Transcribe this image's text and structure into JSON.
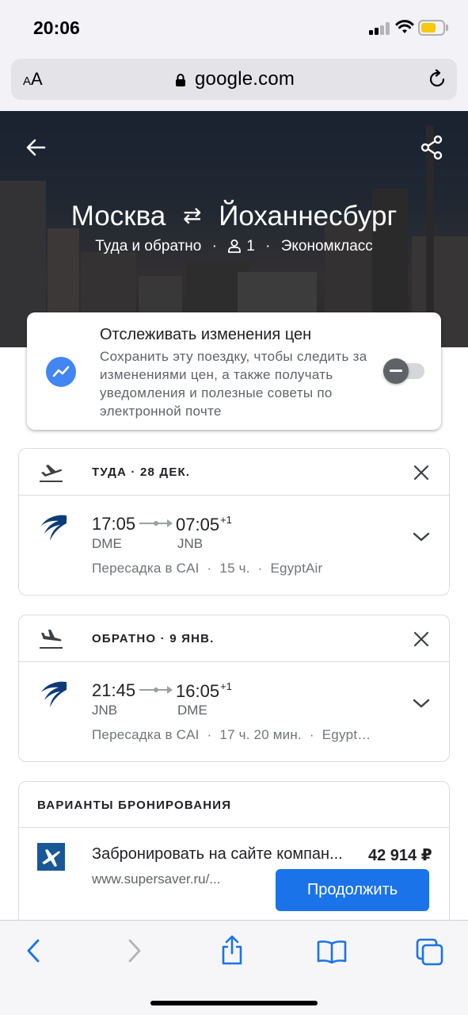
{
  "status_bar": {
    "time": "20:06",
    "battery_level": 0.7,
    "battery_color": "#f7c811"
  },
  "browser": {
    "text_size_label_small": "A",
    "text_size_label_large": "A",
    "url": "google.com"
  },
  "hero": {
    "origin": "Москва",
    "destination": "Йоханнесбург",
    "swap_glyph": "⇄",
    "trip_type": "Туда и обратно",
    "passengers": "1",
    "cabin_class": "Экономкласс",
    "separator": "·"
  },
  "price_tracking": {
    "title": "Отслеживать изменения цен",
    "description": "Сохранить эту поездку, чтобы следить за изменениями цен, а также получать уведомления и полезные советы по электронной почте",
    "enabled": false
  },
  "flights": [
    {
      "label": "ТУДА · 28 ДЕК.",
      "depart_time": "17:05",
      "arrive_time": "07:05",
      "day_offset": "+1",
      "from_code": "DME",
      "to_code": "JNB",
      "stop": "Пересадка в CAI",
      "duration": "15 ч.",
      "airline": "EgyptAir",
      "sep": "·"
    },
    {
      "label": "ОБРАТНО · 9 ЯНВ.",
      "depart_time": "21:45",
      "arrive_time": "16:05",
      "day_offset": "+1",
      "from_code": "JNB",
      "to_code": "DME",
      "stop": "Пересадка в CAI",
      "duration": "17 ч. 20 мин.",
      "airline": "Egypt…",
      "sep": "·"
    }
  ],
  "booking": {
    "title": "ВАРИАНТЫ БРОНИРОВАНИЯ",
    "option_name": "Забронировать на сайте компан...",
    "price": "42 914 ₽",
    "url": "www.supersaver.ru/...",
    "button_label": "Продолжить"
  },
  "colors": {
    "accent": "#1a73e8",
    "track_icon": "#4285f4",
    "airline": "#0d3b78"
  }
}
